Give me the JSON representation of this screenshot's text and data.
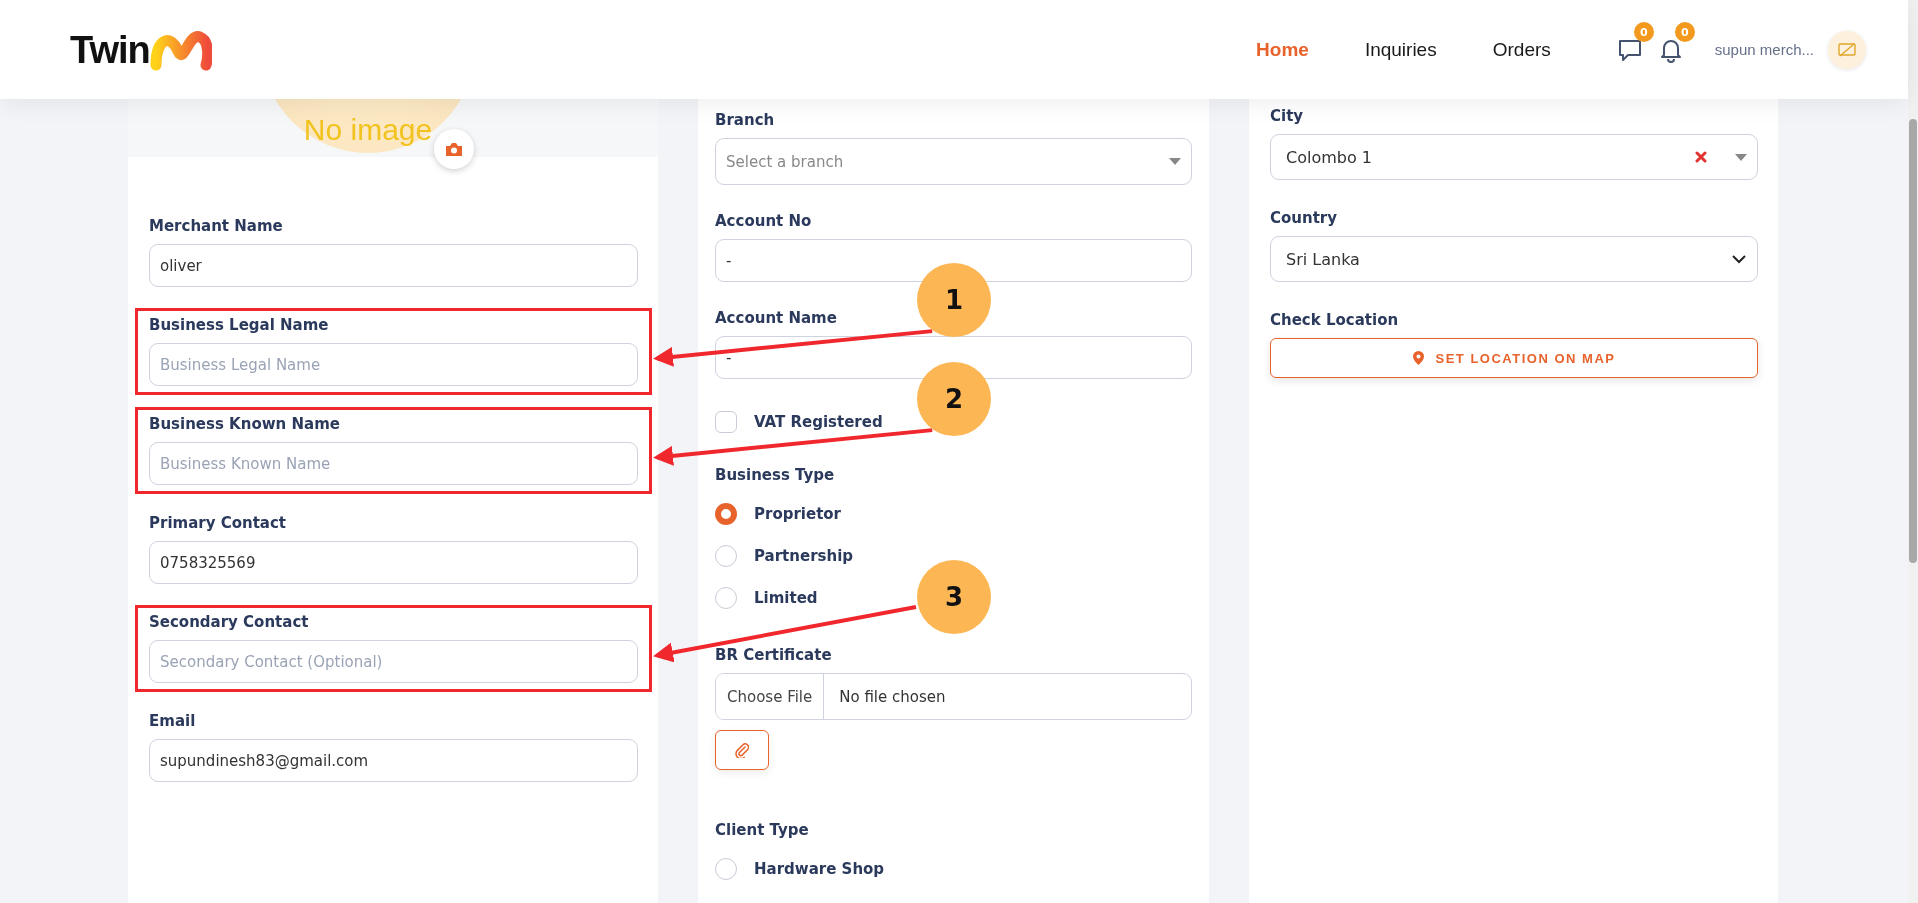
{
  "header": {
    "logo": "Twin",
    "nav": [
      {
        "label": "Home",
        "selected": true
      },
      {
        "label": "Inquiries",
        "selected": false
      },
      {
        "label": "Orders",
        "selected": false
      }
    ],
    "message_count": "0",
    "notification_count": "0",
    "user_name": "supun merch..."
  },
  "profile": {
    "image_text": "No image"
  },
  "columns": [
    {
      "fields": [
        {
          "kind": "text",
          "label": "Merchant Name",
          "value": "oliver"
        },
        {
          "kind": "text",
          "label": "Business Legal Name",
          "placeholder": "Business Legal Name",
          "callout": "1"
        },
        {
          "kind": "text",
          "label": "Business Known Name",
          "placeholder": "Business Known Name",
          "callout": "2"
        },
        {
          "kind": "text",
          "label": "Primary Contact",
          "value": "0758325569"
        },
        {
          "kind": "text",
          "label": "Secondary Contact",
          "placeholder": "Secondary Contact (Optional)",
          "callout": "3"
        },
        {
          "kind": "text",
          "label": "Email",
          "value": "supundinesh83@gmail.com"
        }
      ]
    },
    {
      "fields": [
        {
          "kind": "select",
          "label": "Branch",
          "placeholder": "Select a branch"
        },
        {
          "kind": "text",
          "label": "Account No",
          "value": "-"
        },
        {
          "kind": "text",
          "label": "Account Name",
          "value": "-"
        },
        {
          "kind": "checkbox",
          "label": "VAT Registered",
          "checked": false
        },
        {
          "kind": "radios",
          "label": "Business Type",
          "options": [
            {
              "label": "Proprietor",
              "selected": true
            },
            {
              "label": "Partnership",
              "selected": false
            },
            {
              "label": "Limited",
              "selected": false
            }
          ]
        },
        {
          "kind": "file",
          "label": "BR Certificate",
          "button": "Choose File",
          "status": "No file chosen"
        },
        {
          "kind": "radios",
          "label": "Client Type",
          "options": [
            {
              "label": "Hardware Shop",
              "selected": false
            }
          ]
        }
      ]
    },
    {
      "fields": [
        {
          "kind": "select",
          "label": "City",
          "value": "Colombo 1",
          "clearable": true
        },
        {
          "kind": "dropdown",
          "label": "Country",
          "value": "Sri Lanka"
        },
        {
          "kind": "button",
          "label": "Check Location",
          "button": "SET LOCATION ON MAP"
        }
      ]
    }
  ]
}
